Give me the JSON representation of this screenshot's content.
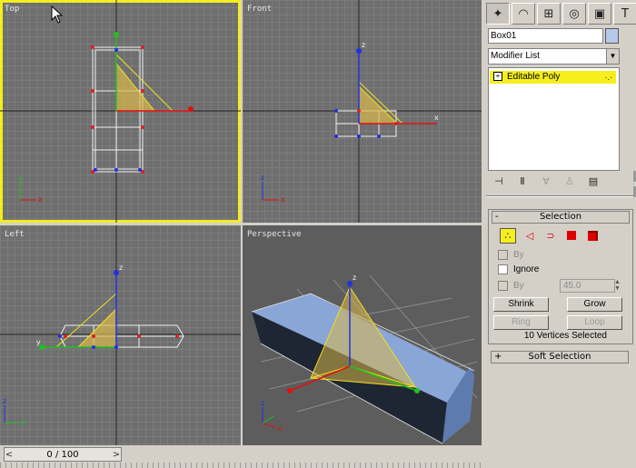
{
  "viewports": {
    "top": {
      "label": "Top"
    },
    "front": {
      "label": "Front"
    },
    "left": {
      "label": "Left"
    },
    "perspective": {
      "label": "Perspective"
    }
  },
  "axis_labels": {
    "x": "x",
    "y": "y",
    "z": "z"
  },
  "time_slider": {
    "value": "0 / 100",
    "prev": "<",
    "next": ">"
  },
  "command_panel": {
    "tabs": [
      {
        "icon": "create-icon",
        "selected": true
      },
      {
        "icon": "modify-icon",
        "selected": false
      },
      {
        "icon": "hierarchy-icon",
        "selected": false
      },
      {
        "icon": "motion-icon",
        "selected": false
      },
      {
        "icon": "display-icon",
        "selected": false
      },
      {
        "icon": "utilities-icon",
        "selected": false
      }
    ],
    "object_name": "Box01",
    "object_color": "#b5c9e8",
    "modifier_list": "Modifier List",
    "stack": [
      {
        "label": "Editable Poly",
        "expand": "+"
      }
    ],
    "selection_rollout": {
      "title": "Selection",
      "collapse": "-",
      "by_vertex_label": "By",
      "ignore_label": "Ignore",
      "by_angle_label": "By",
      "angle_value": "45.0",
      "shrink": "Shrink",
      "grow": "Grow",
      "ring": "Ring",
      "loop": "Loop",
      "status": "10 Vertices Selected"
    },
    "soft_selection_rollout": {
      "title": "Soft Selection",
      "expand": "+"
    }
  },
  "colors": {
    "active_viewport": "#f2ee20",
    "selection_highlight": "#f6ef1c",
    "viewport_grid": "#6f6f6f"
  }
}
